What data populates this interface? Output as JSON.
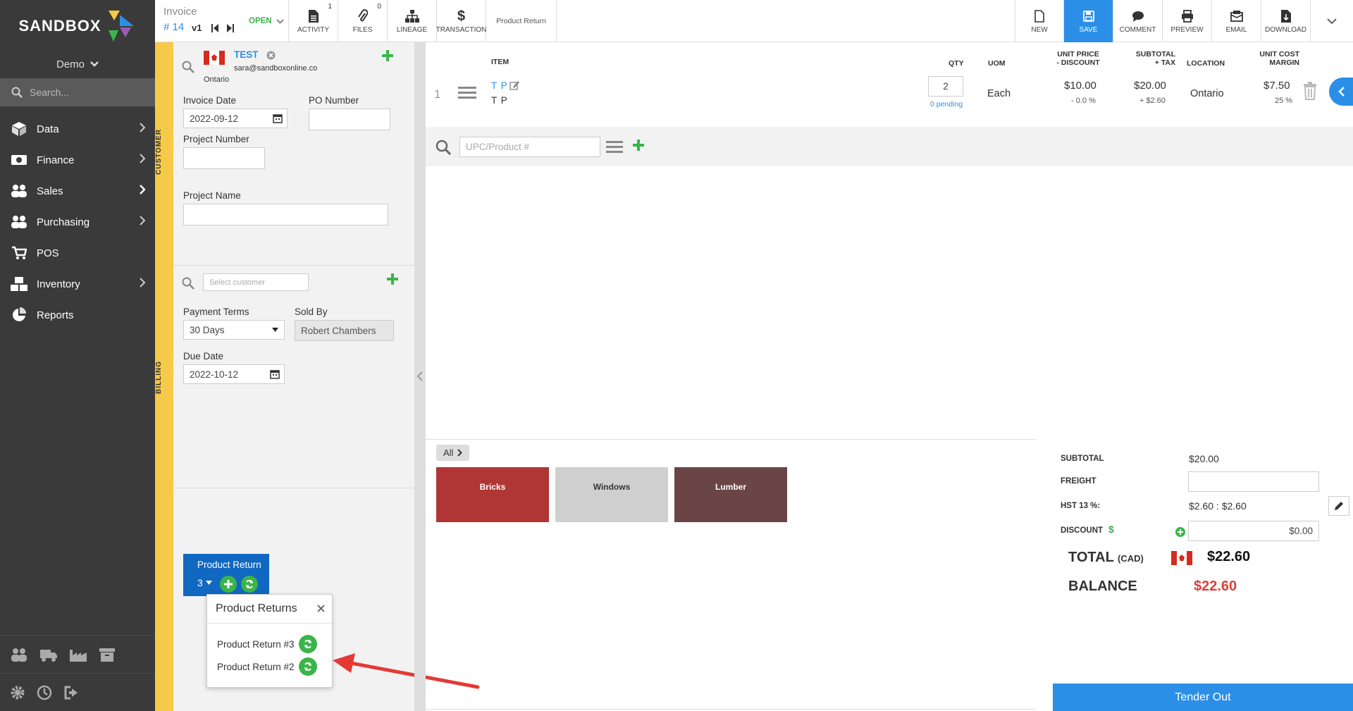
{
  "sidebar": {
    "brand": "SANDBOX",
    "workspace": "Demo",
    "search_placeholder": "Search...",
    "items": [
      {
        "label": "Data",
        "icon": "cube-icon"
      },
      {
        "label": "Finance",
        "icon": "money-icon"
      },
      {
        "label": "Sales",
        "icon": "users-icon"
      },
      {
        "label": "Purchasing",
        "icon": "users-icon"
      },
      {
        "label": "POS",
        "icon": "cart-icon"
      },
      {
        "label": "Inventory",
        "icon": "boxes-icon"
      },
      {
        "label": "Reports",
        "icon": "pie-chart-icon"
      }
    ]
  },
  "topbar": {
    "doc_type": "Invoice",
    "doc_number": "# 14",
    "version": "v1",
    "status": "OPEN",
    "activity_label": "ACTIVITY",
    "activity_count": "1",
    "files_label": "FILES",
    "files_count": "0",
    "lineage_label": "LINEAGE",
    "transaction_label": "TRANSACTION",
    "context_label": "Product Return",
    "new_label": "NEW",
    "save_label": "SAVE",
    "comment_label": "COMMENT",
    "preview_label": "PREVIEW",
    "email_label": "EMAIL",
    "download_label": "DOWNLOAD"
  },
  "strip": {
    "customer": "CUSTOMER",
    "billing": "BILLING"
  },
  "customer": {
    "name": "TEST",
    "email": "sara@sandboxonline.co",
    "region": "Ontario",
    "invoice_date_label": "Invoice Date",
    "invoice_date": "2022-09-12",
    "po_number_label": "PO Number",
    "po_number": "",
    "project_number_label": "Project Number",
    "project_number": "",
    "project_name_label": "Project Name",
    "project_name": ""
  },
  "billing": {
    "select_placeholder": "Select customer",
    "payment_terms_label": "Payment Terms",
    "payment_terms": "30 Days",
    "sold_by_label": "Sold By",
    "sold_by": "Robert Chambers",
    "due_date_label": "Due Date",
    "due_date": "2022-10-12"
  },
  "product_return": {
    "title": "Product Return",
    "count": "3",
    "popup_title": "Product Returns",
    "items": [
      "Product Return #3",
      "Product Return #2"
    ]
  },
  "line_table": {
    "headers": {
      "item": "ITEM",
      "qty": "QTY",
      "uom": "UOM",
      "unit_price_1": "UNIT PRICE",
      "unit_price_2": "- DISCOUNT",
      "subtotal_1": "SUBTOTAL",
      "subtotal_2": "+ TAX",
      "location": "LOCATION",
      "unit_cost_1": "UNIT COST",
      "unit_cost_2": "MARGIN"
    },
    "rows": [
      {
        "num": "1",
        "item_code": "T P",
        "item_name": "T P",
        "qty": "2",
        "pending": "0 pending",
        "uom": "Each",
        "unit_price": "$10.00",
        "discount": "- 0.0 %",
        "subtotal": "$20.00",
        "tax": "+ $2.60",
        "location": "Ontario",
        "unit_cost": "$7.50",
        "margin": "25 %"
      }
    ],
    "upc_placeholder": "UPC/Product #"
  },
  "pos": {
    "all_label": "All",
    "categories": [
      {
        "label": "Bricks",
        "color": "#b03535",
        "text_color": "#ffffff"
      },
      {
        "label": "Windows",
        "color": "#cfcfcf",
        "text_color": "#333333"
      },
      {
        "label": "Lumber",
        "color": "#6b4545",
        "text_color": "#ffffff"
      }
    ]
  },
  "totals": {
    "subtotal_label": "SUBTOTAL",
    "subtotal": "$20.00",
    "freight_label": "FREIGHT",
    "freight": "",
    "hst_label": "HST 13 %:",
    "hst": "$2.60 : $2.60",
    "discount_label": "DISCOUNT",
    "discount_symbol": "$",
    "discount": "$0.00",
    "total_label": "TOTAL",
    "total_currency": "(CAD)",
    "total": "$22.60",
    "balance_label": "BALANCE",
    "balance": "$22.60",
    "tender_label": "Tender Out"
  }
}
